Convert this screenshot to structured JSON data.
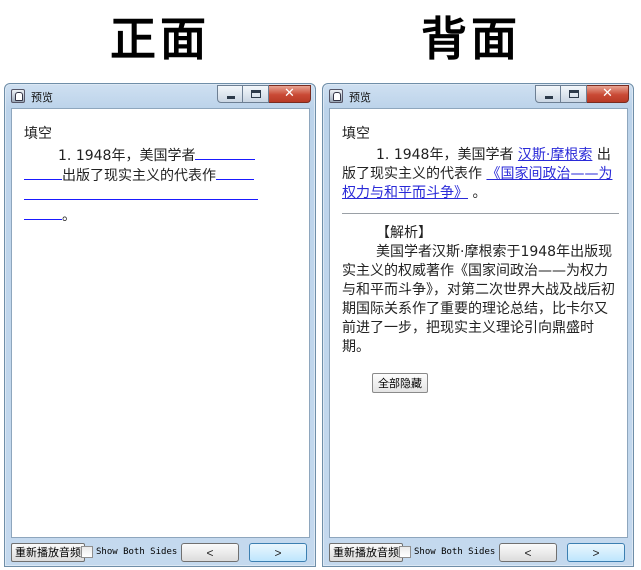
{
  "labels": {
    "front": "正面",
    "back": "背面"
  },
  "window": {
    "title": "预览"
  },
  "front": {
    "type": "填空",
    "number": "1.",
    "text_before": "1948年，美国学者",
    "text_mid": "出版了现实主义的代表作",
    "text_end": "。"
  },
  "back": {
    "type": "填空",
    "number": "1.",
    "text_before": "1948年，美国学者",
    "answer1": "汉斯·摩根索",
    "text_mid": "出版了现实主义的代表作",
    "answer2": "《国家间政治——为权力与和平而斗争》",
    "text_end": "。",
    "explanation_heading": "【解析】",
    "explanation": "美国学者汉斯·摩根索于1948年出版现实主义的权威著作《国家间政治——为权力与和平而斗争》，对第二次世界大战及战后初期国际关系作了重要的理论总结，比卡尔又前进了一步，把现实主义理论引向鼎盛时期。",
    "hide_all_label": "全部隐藏"
  },
  "bottom": {
    "replay_label": "重新播放音频",
    "show_both_label": "Show Both Sides",
    "show_both_checked": false,
    "prev_label": "<",
    "next_label": ">"
  },
  "colors": {
    "answer_blue": "#2a2ad8",
    "window_frame": "#bcd3ea",
    "close_button": "#c94a35"
  }
}
